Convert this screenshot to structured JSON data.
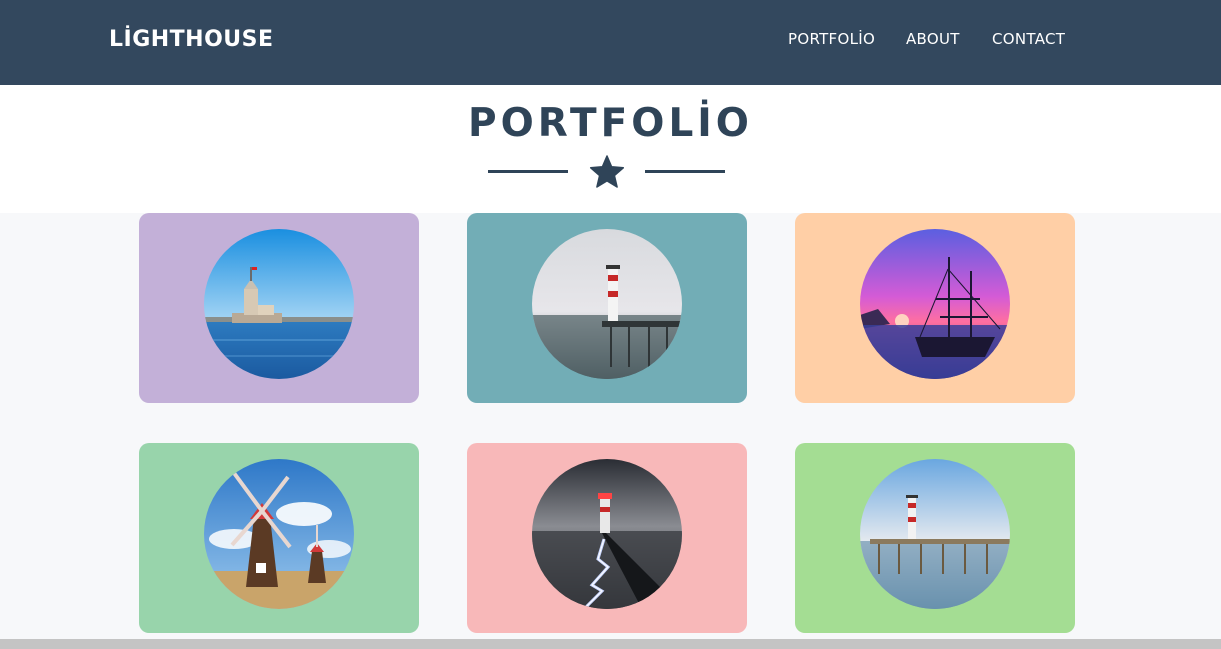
{
  "navbar": {
    "brand": "LİGHTHOUSE",
    "links": [
      {
        "label": "PORTFOLİO"
      },
      {
        "label": "ABOUT"
      },
      {
        "label": "CONTACT"
      }
    ]
  },
  "hero": {
    "title": "PORTFOLİO",
    "icon": "star-icon"
  },
  "colors": {
    "navbar_bg": "#33485e",
    "title": "#2f4458",
    "cards": [
      "#c3b0d8",
      "#72adb6",
      "#ffcfa6",
      "#98d4ab",
      "#f8b8b9",
      "#a4dd93"
    ]
  },
  "portfolio": {
    "items": [
      {
        "image": "maidens-tower-photo"
      },
      {
        "image": "lighthouse-pier-photo"
      },
      {
        "image": "sailing-ship-sunset-photo"
      },
      {
        "image": "windmills-photo"
      },
      {
        "image": "lighthouse-light-trail-photo"
      },
      {
        "image": "lighthouse-jetty-photo"
      }
    ]
  }
}
